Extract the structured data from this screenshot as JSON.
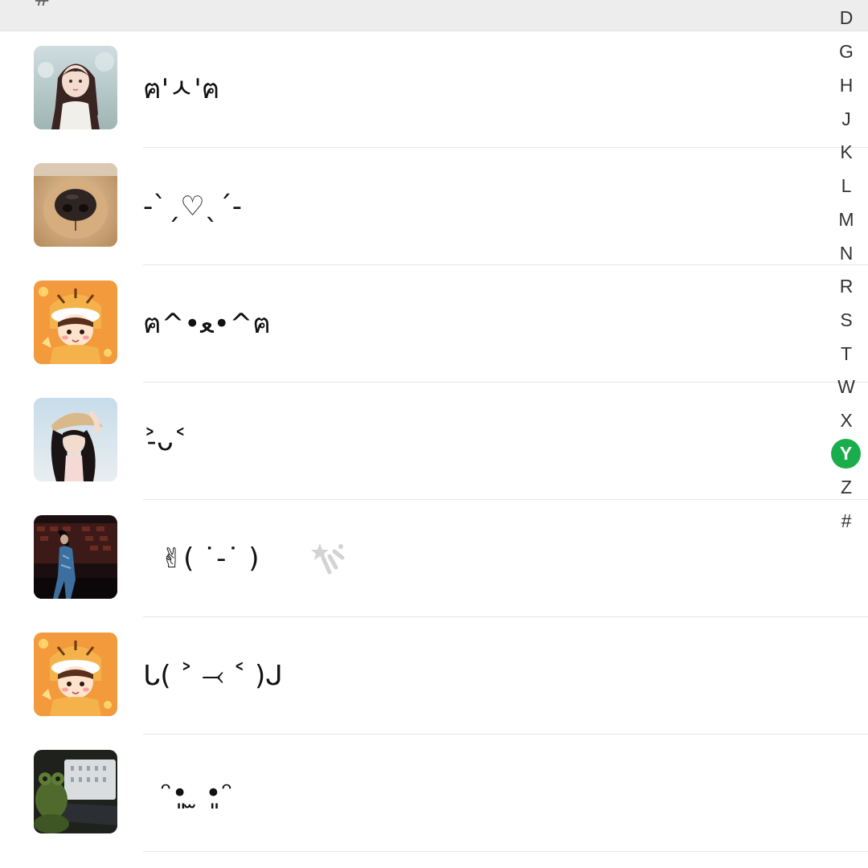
{
  "section_header": {
    "label": "#"
  },
  "contacts": [
    {
      "name": "ฅ'ㅅ'ฅ",
      "avatar": "girl-braids-avatar"
    },
    {
      "name": "-`ˏ♡ˎˊ-",
      "avatar": "dog-nose-avatar"
    },
    {
      "name": "ฅ^•ﻌ•^ฅ",
      "avatar": "tiger-costume-girl-avatar"
    },
    {
      "name": "˃̵ᴗ˂",
      "avatar": "girl-cap-avatar"
    },
    {
      "name": "  ✌︎( ˙-˙ )  ",
      "avatar": "night-street-avatar"
    },
    {
      "name": "ᒐ( ˃ ⤙ ˂ )ᒍ",
      "avatar": "tiger-costume-girl-avatar"
    },
    {
      "name": "  ᵔ•͈ ̫ •͈ᵔ",
      "avatar": "frog-plush-laptop-avatar"
    }
  ],
  "index_bar": {
    "letters": [
      "D",
      "G",
      "H",
      "J",
      "K",
      "L",
      "M",
      "N",
      "R",
      "S",
      "T",
      "W",
      "X",
      "Y",
      "Z",
      "#"
    ],
    "active": "Y",
    "active_color": "#1aad4b"
  }
}
